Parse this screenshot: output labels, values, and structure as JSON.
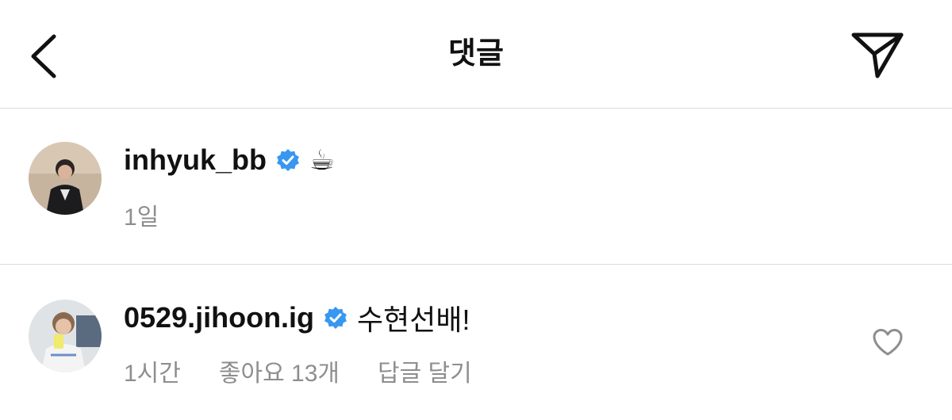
{
  "header": {
    "title": "댓글",
    "back_icon": "chevron-left-icon",
    "send_icon": "paper-plane-icon"
  },
  "caption": {
    "username": "inhyuk_bb",
    "verified": true,
    "text": "☕",
    "time": "1일"
  },
  "comments": [
    {
      "username": "0529.jihoon.ig",
      "verified": true,
      "text": "수현선배!",
      "time": "1시간",
      "likes": "좋아요 13개",
      "reply_label": "답글 달기",
      "like_icon": "heart-outline-icon"
    }
  ],
  "colors": {
    "verified_blue": "#3897f0",
    "meta_gray": "#8e8e8e",
    "divider": "#dbdbdb"
  }
}
